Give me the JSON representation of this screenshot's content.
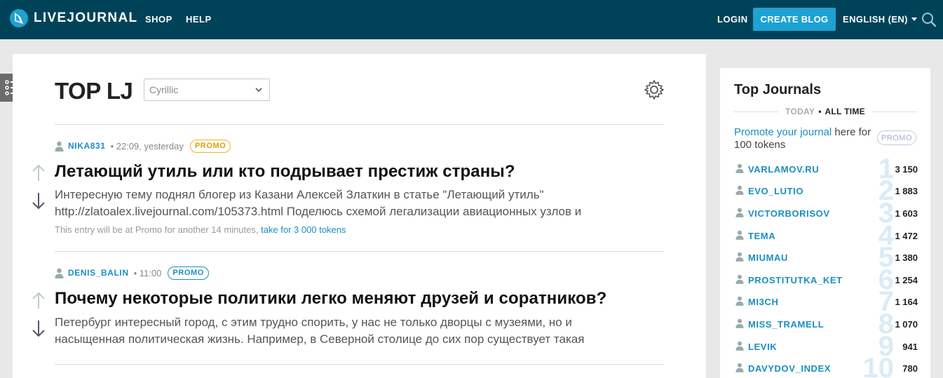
{
  "header": {
    "logo_text": "LIVEJOURNAL",
    "nav": [
      "SHOP",
      "HELP"
    ],
    "login": "LOGIN",
    "create_blog": "CREATE BLOG",
    "language": "ENGLISH (EN)"
  },
  "main": {
    "title": "TOP LJ",
    "filter_value": "Cyrillic",
    "posts": [
      {
        "author": "NIKA831",
        "time": "• 22:09, yesterday",
        "promo": "PROMO",
        "title": "Летающий утиль или кто подрывает престиж страны?",
        "excerpt_1": "Интересную тему поднял блогер из Казани Алексей Златкин в статье \"Летающий утиль\"",
        "excerpt_2": "http://zlatoalex.livejournal.com/105373.html Поделюсь схемой легализации авиационных узлов и",
        "note": "This entry will be at Promo for another 14 minutes,",
        "note_link": "take for 3 000 tokens"
      },
      {
        "author": "DENIS_BALIN",
        "time": "• 11:00",
        "promo": "PROMO",
        "title": "Почему некоторые политики легко меняют друзей и соратников?",
        "excerpt_1": "Петербург интересный город, с этим трудно спорить, у нас не только дворцы с музеями, но и",
        "excerpt_2": "насыщенная политическая жизнь. Например, в Северной столице до сих пор существует такая"
      }
    ]
  },
  "sidebar": {
    "title": "Top Journals",
    "period_inactive": "TODAY",
    "period_active": "ALL TIME",
    "promote_link": "Promote your journal",
    "promote_text": " here for 100 tokens",
    "promo_badge": "PROMO",
    "journals": [
      {
        "rank": "1",
        "name": "VARLAMOV.RU",
        "score": "3 150"
      },
      {
        "rank": "2",
        "name": "EVO_LUTIO",
        "score": "1 883"
      },
      {
        "rank": "3",
        "name": "VICTORBORISOV",
        "score": "1 603"
      },
      {
        "rank": "4",
        "name": "TEMA",
        "score": "1 472"
      },
      {
        "rank": "5",
        "name": "MIUMAU",
        "score": "1 380"
      },
      {
        "rank": "6",
        "name": "PROSTITUTKA_KET",
        "score": "1 254"
      },
      {
        "rank": "7",
        "name": "MI3CH",
        "score": "1 164"
      },
      {
        "rank": "8",
        "name": "MISS_TRAMELL",
        "score": "1 070"
      },
      {
        "rank": "9",
        "name": "LEVIK",
        "score": "941"
      },
      {
        "rank": "10",
        "name": "DAVYDOV_INDEX",
        "score": "780"
      }
    ]
  },
  "colors": {
    "header_bg": "#004359",
    "accent": "#1da2d2",
    "link": "#1a8fbe",
    "promo_gold": "#f0b429"
  }
}
